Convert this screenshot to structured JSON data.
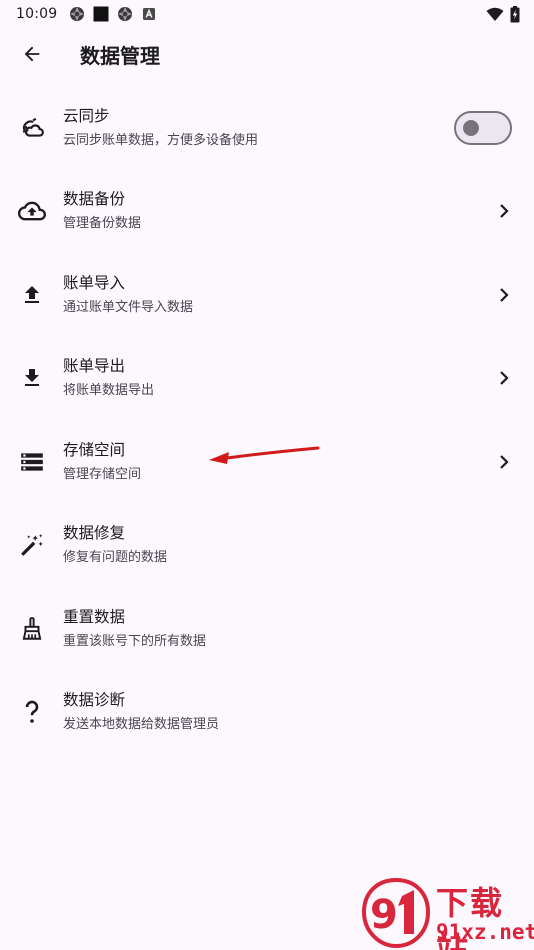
{
  "status_bar": {
    "time": "10:09",
    "left_icons": [
      "aperture-icon",
      "black-square-icon",
      "aperture-icon",
      "a-badge-icon"
    ],
    "right_icons": [
      "wifi-icon",
      "battery-charging-icon"
    ]
  },
  "app_bar": {
    "back_icon": "arrow-left-icon",
    "title": "数据管理"
  },
  "items": [
    {
      "icon": "cloud-sync-icon",
      "title": "云同步",
      "subtitle": "云同步账单数据，方便多设备使用",
      "control": "toggle",
      "toggle_on": false
    },
    {
      "icon": "cloud-upload-icon",
      "title": "数据备份",
      "subtitle": "管理备份数据",
      "control": "chevron"
    },
    {
      "icon": "upload-icon",
      "title": "账单导入",
      "subtitle": "通过账单文件导入数据",
      "control": "chevron"
    },
    {
      "icon": "download-icon",
      "title": "账单导出",
      "subtitle": "将账单数据导出",
      "control": "chevron"
    },
    {
      "icon": "storage-icon",
      "title": "存储空间",
      "subtitle": "管理存储空间",
      "control": "chevron"
    },
    {
      "icon": "magic-wand-icon",
      "title": "数据修复",
      "subtitle": "修复有问题的数据",
      "control": "none"
    },
    {
      "icon": "broom-icon",
      "title": "重置数据",
      "subtitle": "重置该账号下的所有数据",
      "control": "none"
    },
    {
      "icon": "question-icon",
      "title": "数据诊断",
      "subtitle": "发送本地数据给数据管理员",
      "control": "none"
    }
  ],
  "annotation": {
    "type": "red-arrow",
    "target": "存储空间",
    "color": "#d11a1a"
  },
  "watermark": {
    "line1": "下载站",
    "line2": "91xz.net",
    "color": "#d9263c"
  },
  "colors": {
    "background": "#fcf8fd",
    "text_primary": "#1c1b1f",
    "text_secondary": "#4a4650",
    "outline": "#77737d"
  }
}
